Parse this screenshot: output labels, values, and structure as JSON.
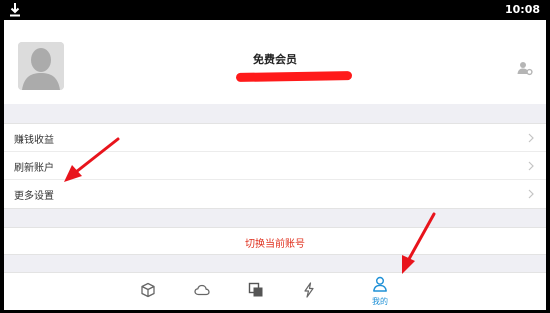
{
  "statusbar": {
    "time": "10:08",
    "download_icon": "download-icon"
  },
  "profile": {
    "member_label": "免费会员",
    "avatar_icon": "avatar-placeholder",
    "action_icon": "user-settings-icon"
  },
  "menu": {
    "items": [
      {
        "label": "赚钱收益"
      },
      {
        "label": "刷新账户"
      },
      {
        "label": "更多设置"
      }
    ]
  },
  "switch_account": {
    "label": "切换当前账号"
  },
  "tabbar": {
    "tabs": [
      {
        "icon": "cube-icon",
        "label": ""
      },
      {
        "icon": "cloud-icon",
        "label": ""
      },
      {
        "icon": "layers-icon",
        "label": ""
      },
      {
        "icon": "lightning-icon",
        "label": ""
      },
      {
        "icon": "person-icon",
        "label": "我的",
        "active": true
      }
    ]
  },
  "colors": {
    "accent": "#1e90d6",
    "danger_text": "#e0301e",
    "annotation": "#e8141c",
    "background": "#efeff4"
  }
}
